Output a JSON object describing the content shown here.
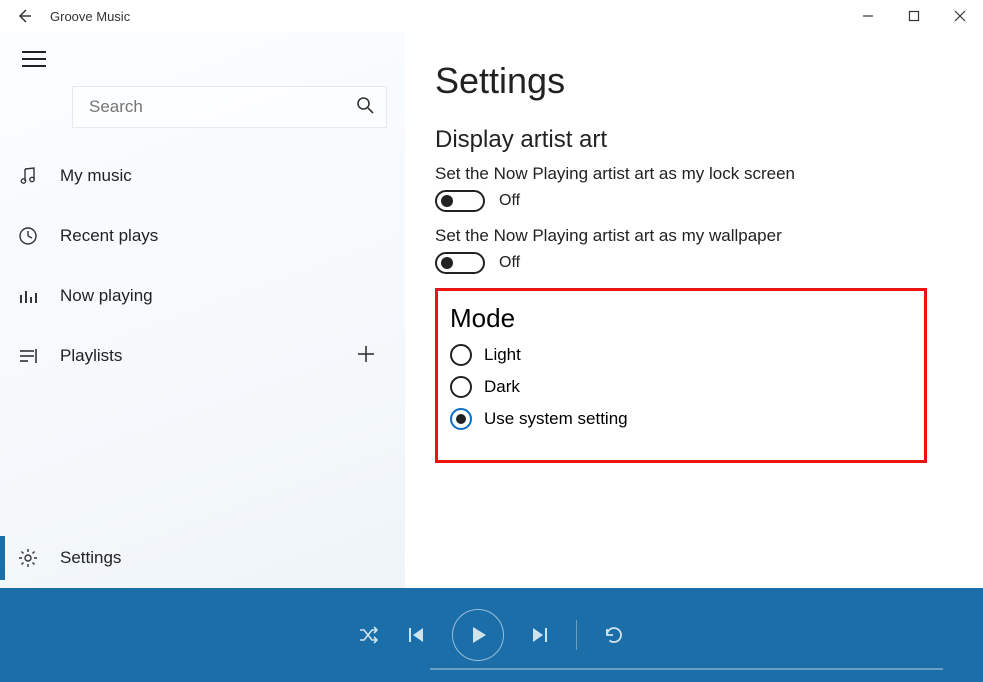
{
  "app": {
    "title": "Groove Music"
  },
  "sidebar": {
    "search_placeholder": "Search",
    "items": [
      {
        "label": "My music"
      },
      {
        "label": "Recent plays"
      },
      {
        "label": "Now playing"
      },
      {
        "label": "Playlists"
      }
    ],
    "settings_label": "Settings"
  },
  "main": {
    "page_title": "Settings",
    "artist_art": {
      "heading": "Display artist art",
      "lock_screen_desc": "Set the Now Playing artist art as my lock screen",
      "lock_screen_state": "Off",
      "wallpaper_desc": "Set the Now Playing artist art as my wallpaper",
      "wallpaper_state": "Off"
    },
    "mode": {
      "heading": "Mode",
      "options": [
        {
          "label": "Light"
        },
        {
          "label": "Dark"
        },
        {
          "label": "Use system setting"
        }
      ],
      "selected_index": 2
    }
  }
}
